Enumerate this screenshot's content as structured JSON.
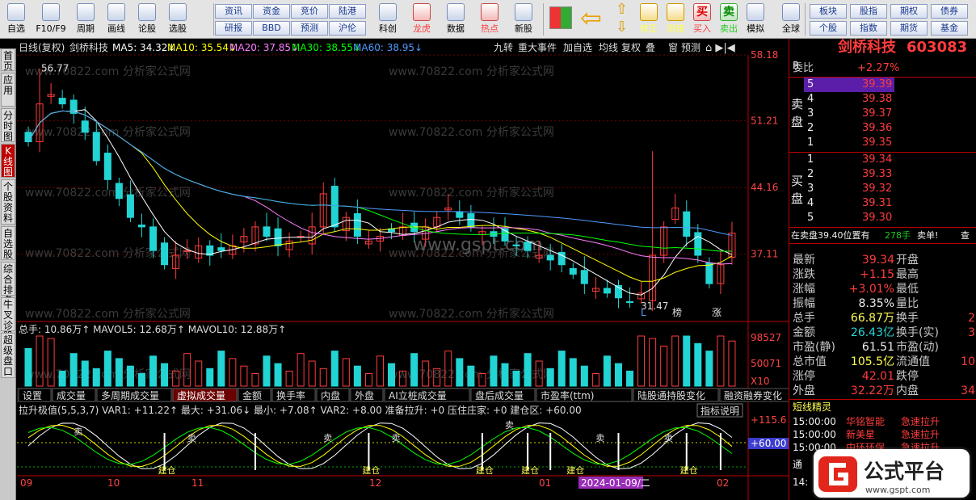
{
  "toolbar": {
    "main": [
      {
        "label": "自选",
        "icon": "star-icon"
      },
      {
        "label": "F10/F9",
        "icon": "f10-icon"
      },
      {
        "label": "周期",
        "icon": "clock-icon"
      },
      {
        "label": "画线",
        "icon": "pencil-icon"
      },
      {
        "label": "论股",
        "icon": "comment-icon"
      },
      {
        "label": "选股",
        "icon": "search-chart-icon"
      }
    ],
    "small_top": [
      "资讯",
      "资金",
      "竞价",
      "陆港"
    ],
    "small_bottom": [
      "研报",
      "BBD",
      "预测",
      "沪伦"
    ],
    "main2": [
      {
        "label": "科创",
        "icon": "chart-icon"
      },
      {
        "label": "龙虎",
        "icon": "dragon-tiger-icon"
      },
      {
        "label": "数据",
        "icon": "pe-icon"
      },
      {
        "label": "热点",
        "icon": "hot-icon"
      },
      {
        "label": "新股",
        "icon": "ipo-icon"
      }
    ],
    "main3": [
      {
        "label": "修正",
        "icon": "bulb-icon"
      },
      {
        "label": "测速",
        "icon": "stopwatch-icon"
      },
      {
        "label": "买入",
        "icon": "buy-icon",
        "char": "买"
      },
      {
        "label": "卖出",
        "icon": "sell-icon",
        "char": "卖"
      },
      {
        "label": "模拟",
        "icon": "hammer-icon"
      },
      {
        "label": "全球",
        "icon": "globe-icon"
      }
    ],
    "right_top": [
      "板块",
      "股指",
      "期权",
      "债券"
    ],
    "right_bottom": [
      "个股",
      "指数",
      "期货",
      "基金"
    ]
  },
  "sidetabs": [
    "首页",
    "应用",
    "分时图",
    "K线图",
    "个股资料",
    "自选股",
    "综合排名",
    "牛叉诊股",
    "超级盘口"
  ],
  "chart_header": {
    "period": "日线(复权)",
    "stock": "剑桥科技",
    "ma5": "MA5: 34.32↓",
    "ma10": "MA10: 35.54↓",
    "ma20": "MA20: 37.85↓",
    "ma30": "MA30: 38.55↓",
    "ma60": "MA60: 38.95↓",
    "buttons": [
      "九转",
      "重大事件",
      "加自选",
      "均线",
      "复权",
      "叠",
      "窗",
      "预测"
    ]
  },
  "price_axis": [
    "58.18",
    "51.21",
    "44.16",
    "37.11"
  ],
  "annotations": {
    "high": "56.77",
    "low": "31.47",
    "bang": "榜",
    "zhang": "涨",
    "L": "L"
  },
  "watermark": "www.gspt.com",
  "watermark2": "www.70822.com 分析家公式网",
  "volume": {
    "header": "总手: 10.86万↑  MAVOL5: 12.68万↑  MAVOL10: 12.88万↑",
    "axis": [
      "98527",
      "50071",
      "X10"
    ],
    "tabs": [
      "设置",
      "成交量",
      "多周期成交量",
      "虚拟成交量",
      "金额",
      "换手率",
      "内盘",
      "外盘",
      "AI立桩成交量",
      "盘后成交量",
      "市盈率(ttm)",
      "陆股通持股变化",
      "融资融券变化"
    ],
    "active_tab": "虚拟成交量"
  },
  "indicator": {
    "header": "拉升极值(5,5,3,7) VAR1: +11.22↑ 最大: +31.06↓ 最小: +7.08↑ VAR2: +8.00 准备拉升: +0 压住庄家: +0 建仓区: +60.00",
    "explain": "指标说明",
    "axis": [
      "+115.6",
      "+60.00"
    ],
    "labels_sell": "卖",
    "labels_build": "建仓"
  },
  "date_axis": [
    "09",
    "10",
    "11",
    "12",
    "01",
    "02"
  ],
  "date_cursor": "2024-01-09/二",
  "right_panel": {
    "name": "剑桥科技",
    "code": "603083",
    "mark": "R",
    "weibi_label": "委比",
    "weibi": "+2.27%",
    "sell": [
      {
        "n": "5",
        "p": "39.39"
      },
      {
        "n": "4",
        "p": "39.38"
      },
      {
        "n": "3",
        "p": "39.37"
      },
      {
        "n": "2",
        "p": "39.36"
      },
      {
        "n": "1",
        "p": "39.35"
      }
    ],
    "buy": [
      {
        "n": "1",
        "p": "39.34"
      },
      {
        "n": "2",
        "p": "39.33"
      },
      {
        "n": "3",
        "p": "39.32"
      },
      {
        "n": "4",
        "p": "39.31"
      },
      {
        "n": "5",
        "p": "39.30"
      }
    ],
    "sell_side_label": "卖盘",
    "buy_side_label": "买盘",
    "info_line": "在卖盘39.40位置有",
    "info_qty": "278手",
    "info_tag": "卖单!",
    "info_more": "查",
    "stats": [
      {
        "l": "最新",
        "v": "39.34",
        "c": "red",
        "l2": "开盘",
        "v2": ""
      },
      {
        "l": "涨跌",
        "v": "+1.15",
        "c": "red",
        "l2": "最高",
        "v2": ""
      },
      {
        "l": "涨幅",
        "v": "+3.01%",
        "c": "red",
        "l2": "最低",
        "v2": ""
      },
      {
        "l": "振幅",
        "v": "8.35%",
        "c": "wht",
        "l2": "量比",
        "v2": ""
      },
      {
        "l": "总手",
        "v": "66.87万",
        "c": "yel",
        "l2": "换手",
        "v2": "2"
      },
      {
        "l": "金额",
        "v": "26.43亿",
        "c": "cya",
        "l2": "换手(实)",
        "v2": "3"
      },
      {
        "l": "市盈(静)",
        "v": "61.51",
        "c": "wht",
        "l2": "市盈(动)",
        "v2": ""
      },
      {
        "l": "总市值",
        "v": "105.5亿",
        "c": "yel",
        "l2": "流通值",
        "v2": "10"
      },
      {
        "l": "涨停",
        "v": "42.01",
        "c": "red",
        "l2": "跌停",
        "v2": ""
      },
      {
        "l": "外盘",
        "v": "32.22万",
        "c": "red",
        "l2": "内盘",
        "v2": "34"
      }
    ],
    "news_title": "短线精灵",
    "news": [
      {
        "t": "15:00:00",
        "s": "华铭智能",
        "e": "急速拉升"
      },
      {
        "t": "15:00:00",
        "s": "新美星",
        "e": "急速拉升"
      },
      {
        "t": "15:00:00",
        "s": "中环环保",
        "e": "急速拉升"
      }
    ],
    "bottom_label1": "通",
    "bottom_label2": "14:"
  },
  "logo": {
    "text": "公式平台",
    "url": "www.gspt.com"
  },
  "colors": {
    "up": "#ff3c3c",
    "down": "#22d4d4",
    "ma5": "#ffffff",
    "ma10": "#ffff00",
    "ma20": "#ff7fff",
    "ma30": "#00ff00",
    "ma60": "#4f9bff"
  },
  "chart_data": {
    "type": "candlestick",
    "dates_axis": [
      "09",
      "10",
      "11",
      "12",
      "01",
      "02"
    ],
    "candles_approx_close": [
      49,
      53,
      54,
      53,
      52,
      50,
      47,
      45,
      43,
      41,
      40,
      37.5,
      36,
      37,
      37.5,
      38,
      37,
      37.5,
      38,
      39,
      40,
      39,
      38,
      38.5,
      39,
      40,
      43.5,
      40,
      41,
      39,
      38.5,
      39,
      39.5,
      40,
      39.5,
      40,
      41,
      42,
      41,
      40,
      39.5,
      39,
      38.5,
      38,
      37.5,
      37,
      36.5,
      36,
      35,
      34,
      33.5,
      33,
      32.5,
      32,
      33,
      37,
      40,
      42,
      39,
      37,
      34,
      36,
      39.34
    ],
    "y_range": [
      30,
      58.18
    ]
  }
}
